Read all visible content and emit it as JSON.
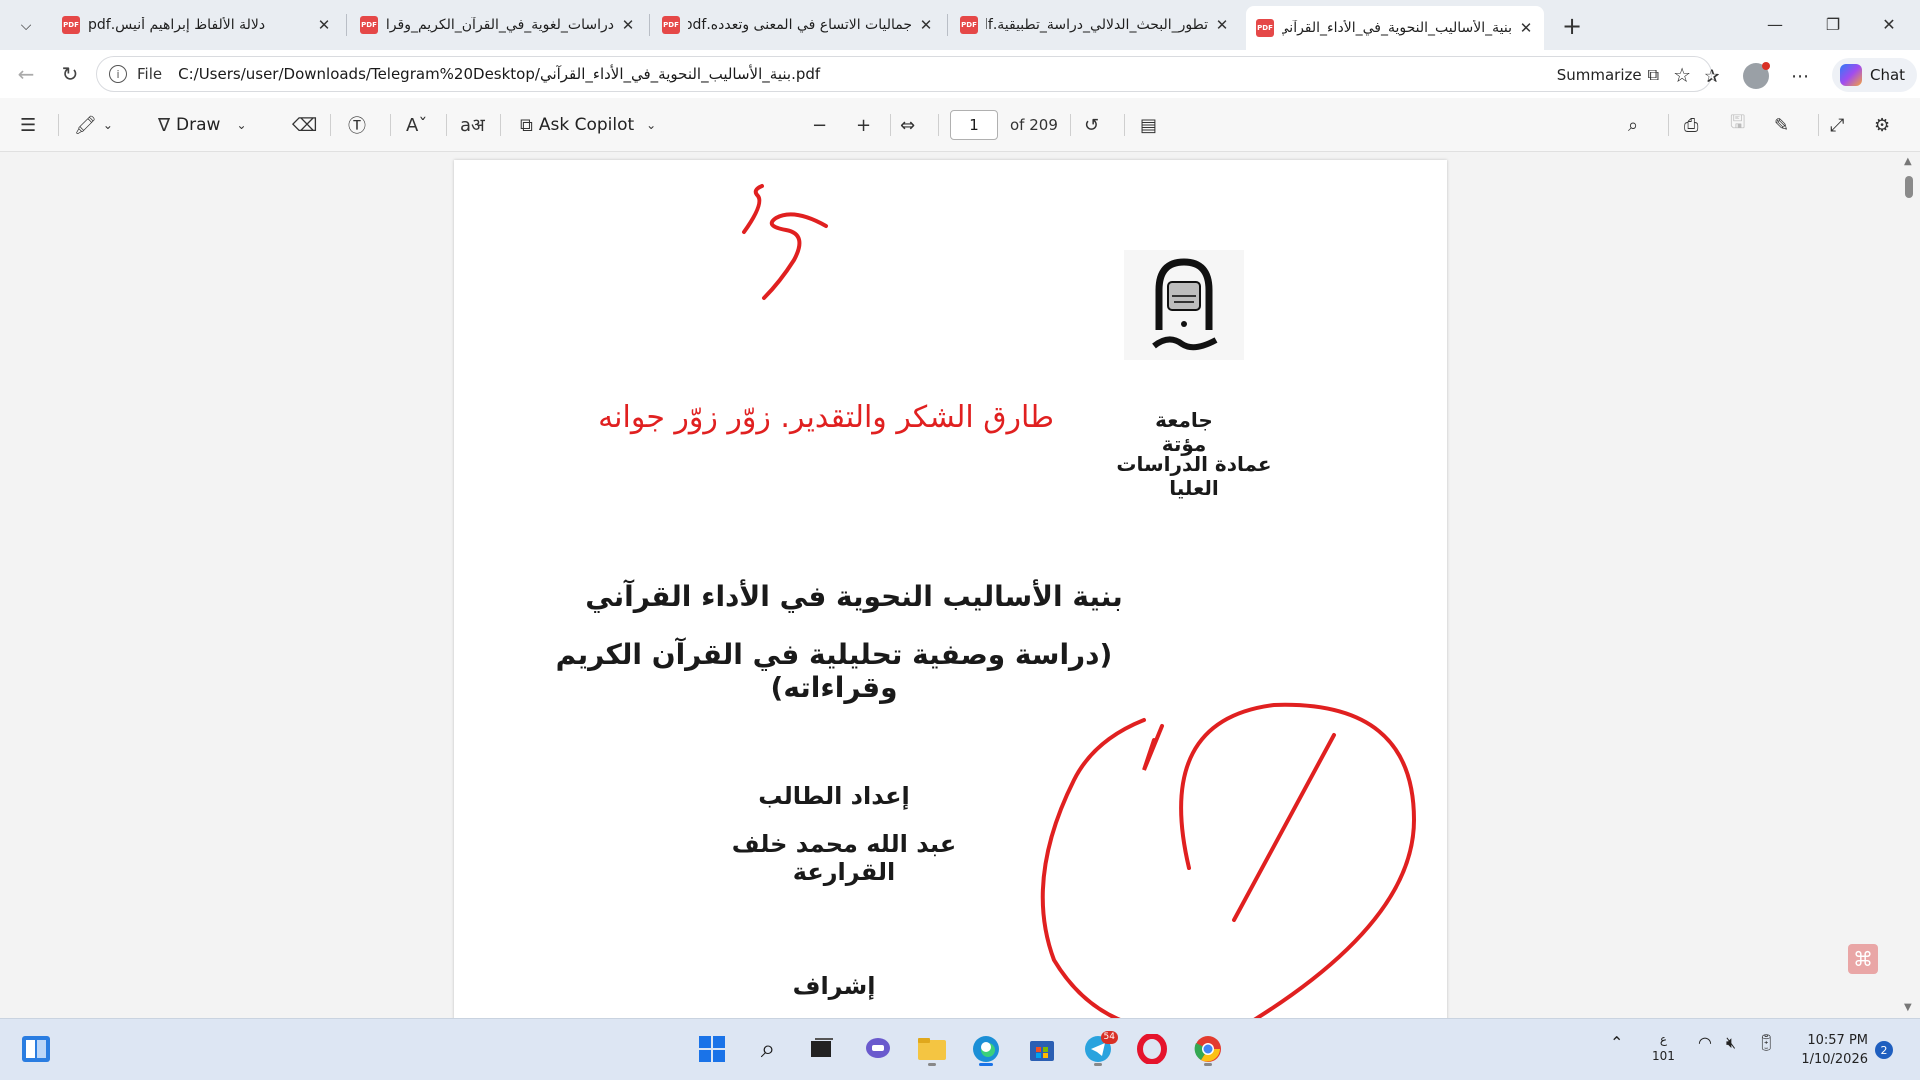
{
  "browser": {
    "tabs": [
      {
        "title": "دلالة الألفاظ إبراهيم أنيس.pdf",
        "active": false
      },
      {
        "title": "دراسات_لغوية_في_القرآن_الكريم_وقراءاته.pdf",
        "active": false
      },
      {
        "title": "جماليات الاتساع في المعنى وتعدده.pdf",
        "active": false
      },
      {
        "title": "تطور_البحث_الدلالي_دراسة_تطبيقية.pdf",
        "active": false
      },
      {
        "title": "بنية_الأساليب_النحوية_في_الأداء_القرآني.pdf",
        "active": true
      }
    ],
    "address": {
      "scheme": "File",
      "url": "C:/Users/user/Downloads/Telegram%20Desktop/بنية_الأساليب_النحوية_في_الأداء_القرآني.pdf",
      "summarize_label": "Summarize"
    },
    "chat_label": "Chat"
  },
  "pdf_toolbar": {
    "draw_label": "Draw",
    "ask_copilot_label": "Ask Copilot",
    "current_page": "1",
    "page_count_label": "of 209"
  },
  "document": {
    "university": "جامعة مؤتة",
    "deanship": "عمادة الدراسات العليا",
    "handwritten_note": "طارق     الشكر والتقدير.  زوّر زوّر جوانه",
    "title": "بنية الأساليب النحوية في الأداء القرآني",
    "subtitle": "(دراسة وصفية تحليلية في القرآن الكريم وقراءاته)",
    "prepared_by_label": "إعداد الطالب",
    "student_name": "عبد الله محمد خلف القرارعة",
    "supervision_label": "إشراف"
  },
  "taskbar": {
    "telegram_badge": "54",
    "lang_line1": "ع",
    "lang_line2": "101",
    "time": "10:57 PM",
    "date": "1/10/2026",
    "notifications": "2"
  },
  "colors": {
    "annotation_red": "#e02020",
    "accent_blue": "#1a73e8",
    "pdf_red": "#e54848"
  }
}
